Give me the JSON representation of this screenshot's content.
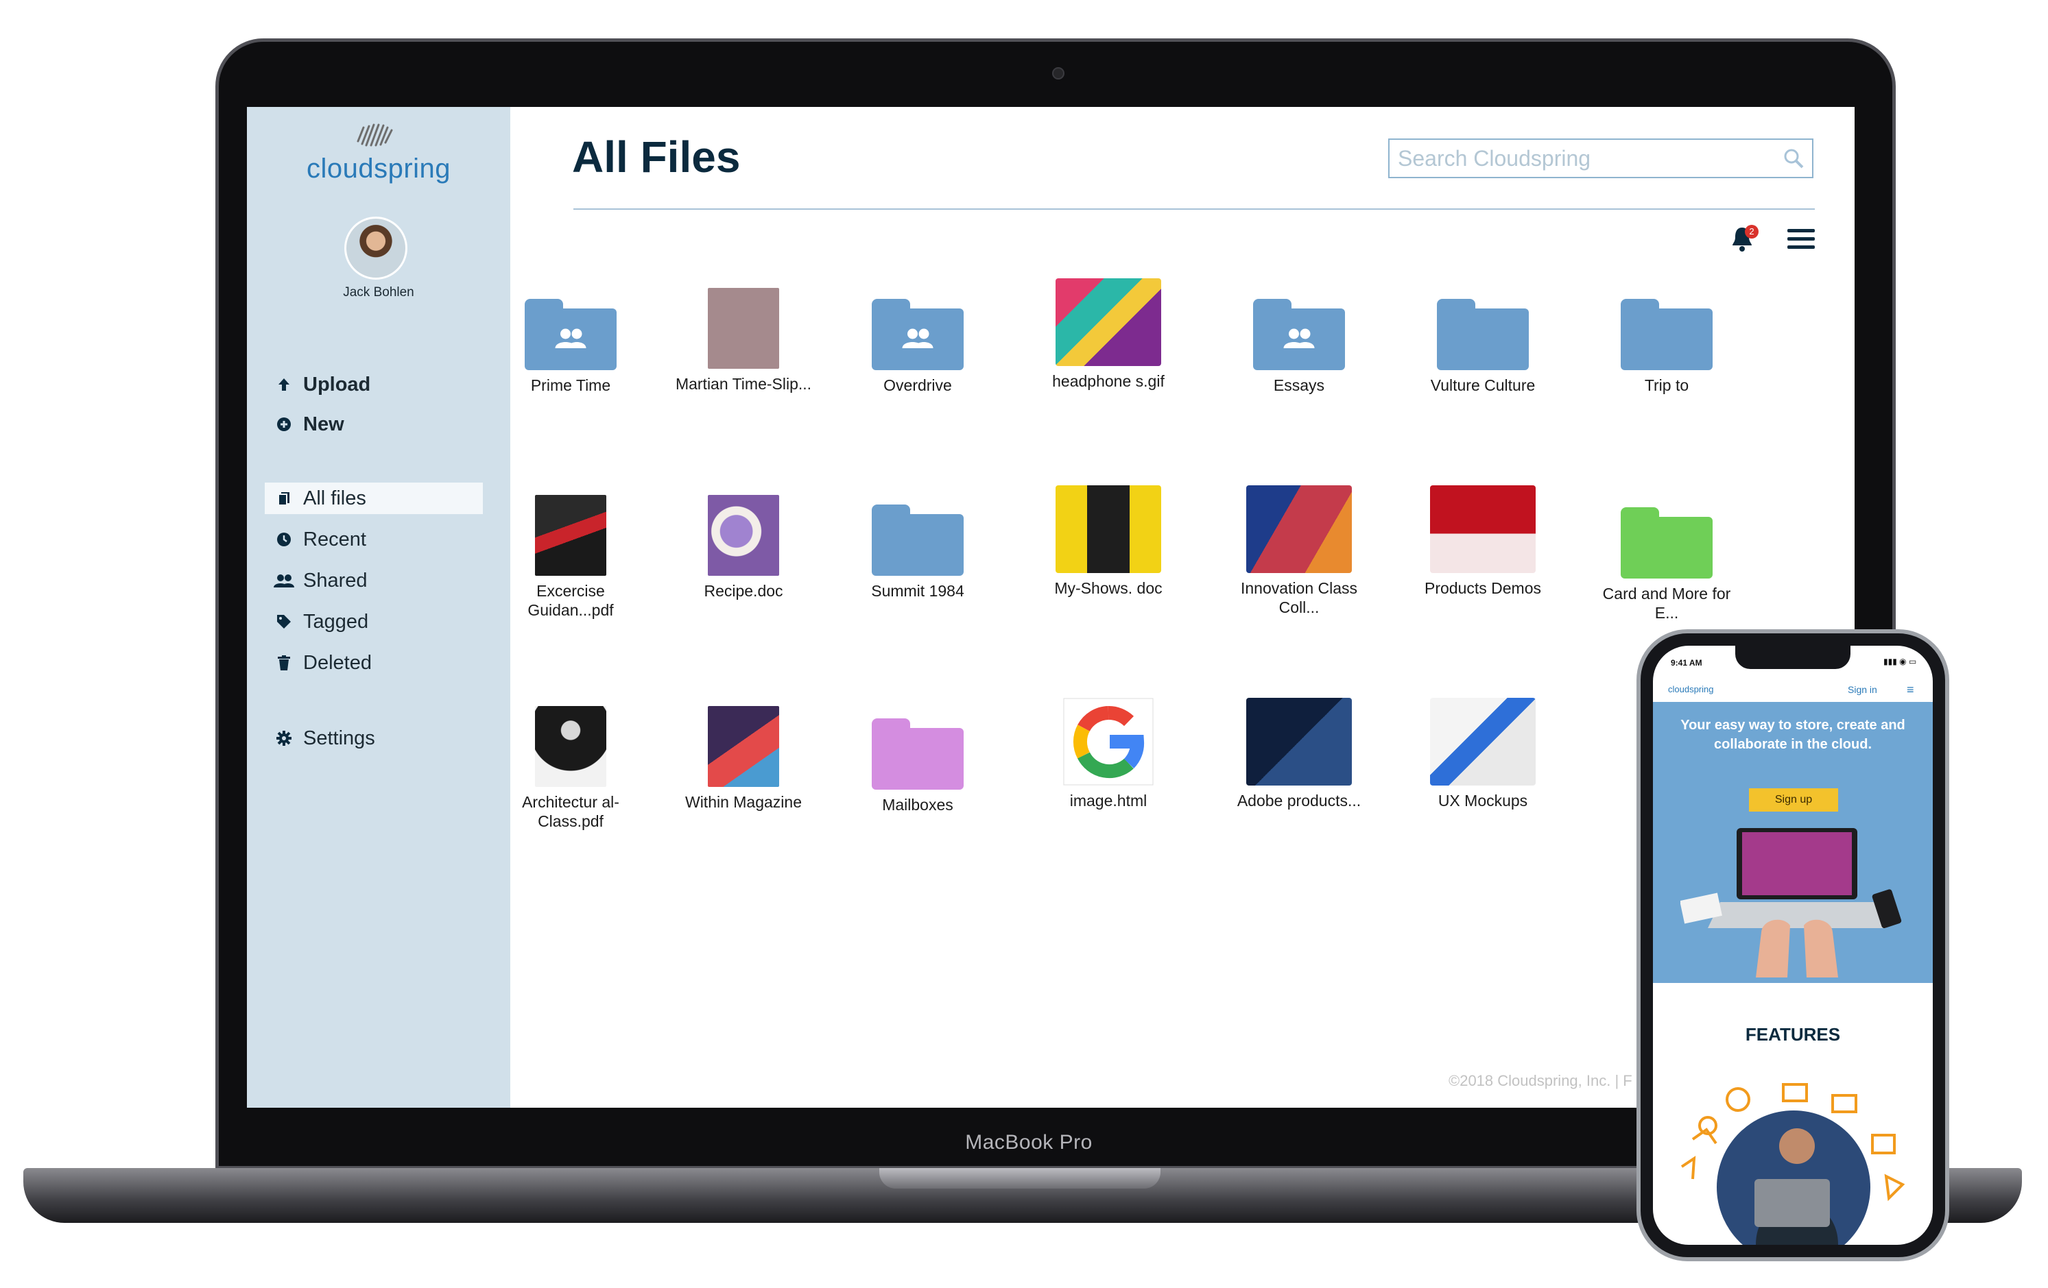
{
  "device": {
    "laptop_model": "MacBook Pro"
  },
  "brand": {
    "name": "cloudspring",
    "accent": "#2a7ab8",
    "sidebar_bg": "#d1e0ea"
  },
  "user": {
    "name": "Jack Bohlen"
  },
  "sidebar": {
    "actions": [
      {
        "label": "Upload",
        "icon": "arrow-up-icon"
      },
      {
        "label": "New",
        "icon": "plus-circle-icon"
      }
    ],
    "nav": [
      {
        "label": "All files",
        "icon": "files-icon",
        "active": true
      },
      {
        "label": "Recent",
        "icon": "clock-icon"
      },
      {
        "label": "Shared",
        "icon": "people-icon"
      },
      {
        "label": "Tagged",
        "icon": "tag-icon"
      },
      {
        "label": "Deleted",
        "icon": "trash-icon"
      }
    ],
    "settings": {
      "label": "Settings",
      "icon": "gear-icon"
    }
  },
  "header": {
    "title": "All Files",
    "search_placeholder": "Search Cloudspring",
    "notification_count": "2"
  },
  "files": [
    {
      "name": "Prime Time",
      "kind": "shared-folder",
      "color": "#6b9ecc"
    },
    {
      "name": "Martian Time-Slip...",
      "kind": "document",
      "color": "#a58a8d"
    },
    {
      "name": "Overdrive",
      "kind": "shared-folder",
      "color": "#6b9ecc"
    },
    {
      "name": "headphone s.gif",
      "kind": "image"
    },
    {
      "name": "Essays",
      "kind": "shared-folder",
      "color": "#6b9ecc"
    },
    {
      "name": "Vulture Culture",
      "kind": "folder",
      "color": "#6b9ecc"
    },
    {
      "name": "Trip to",
      "kind": "folder",
      "color": "#6b9ecc"
    },
    {
      "name": "Excercise Guidan...pdf",
      "kind": "image"
    },
    {
      "name": "Recipe.doc",
      "kind": "image"
    },
    {
      "name": "Summit 1984",
      "kind": "folder",
      "color": "#6b9ecc"
    },
    {
      "name": "My-Shows. doc",
      "kind": "image"
    },
    {
      "name": "Innovation Class Coll...",
      "kind": "image"
    },
    {
      "name": "Products Demos",
      "kind": "image"
    },
    {
      "name": "Card and More for E...",
      "kind": "folder",
      "color": "#6fcf57"
    },
    {
      "name": "Architectur al-Class.pdf",
      "kind": "image"
    },
    {
      "name": "Within Magazine",
      "kind": "image"
    },
    {
      "name": "Mailboxes",
      "kind": "folder",
      "color": "#d48de0"
    },
    {
      "name": "image.html",
      "kind": "google-logo"
    },
    {
      "name": "Adobe products...",
      "kind": "image"
    },
    {
      "name": "UX Mockups",
      "kind": "image"
    }
  ],
  "footer": {
    "text": "©2018 Cloudspring, Inc. | F"
  },
  "phone": {
    "time": "9:41 AM",
    "logo": "cloudspring",
    "signin": "Sign in",
    "hero_text": "Your easy way to store, create and collaborate in the cloud.",
    "signup": "Sign up",
    "features": "FEATURES"
  }
}
